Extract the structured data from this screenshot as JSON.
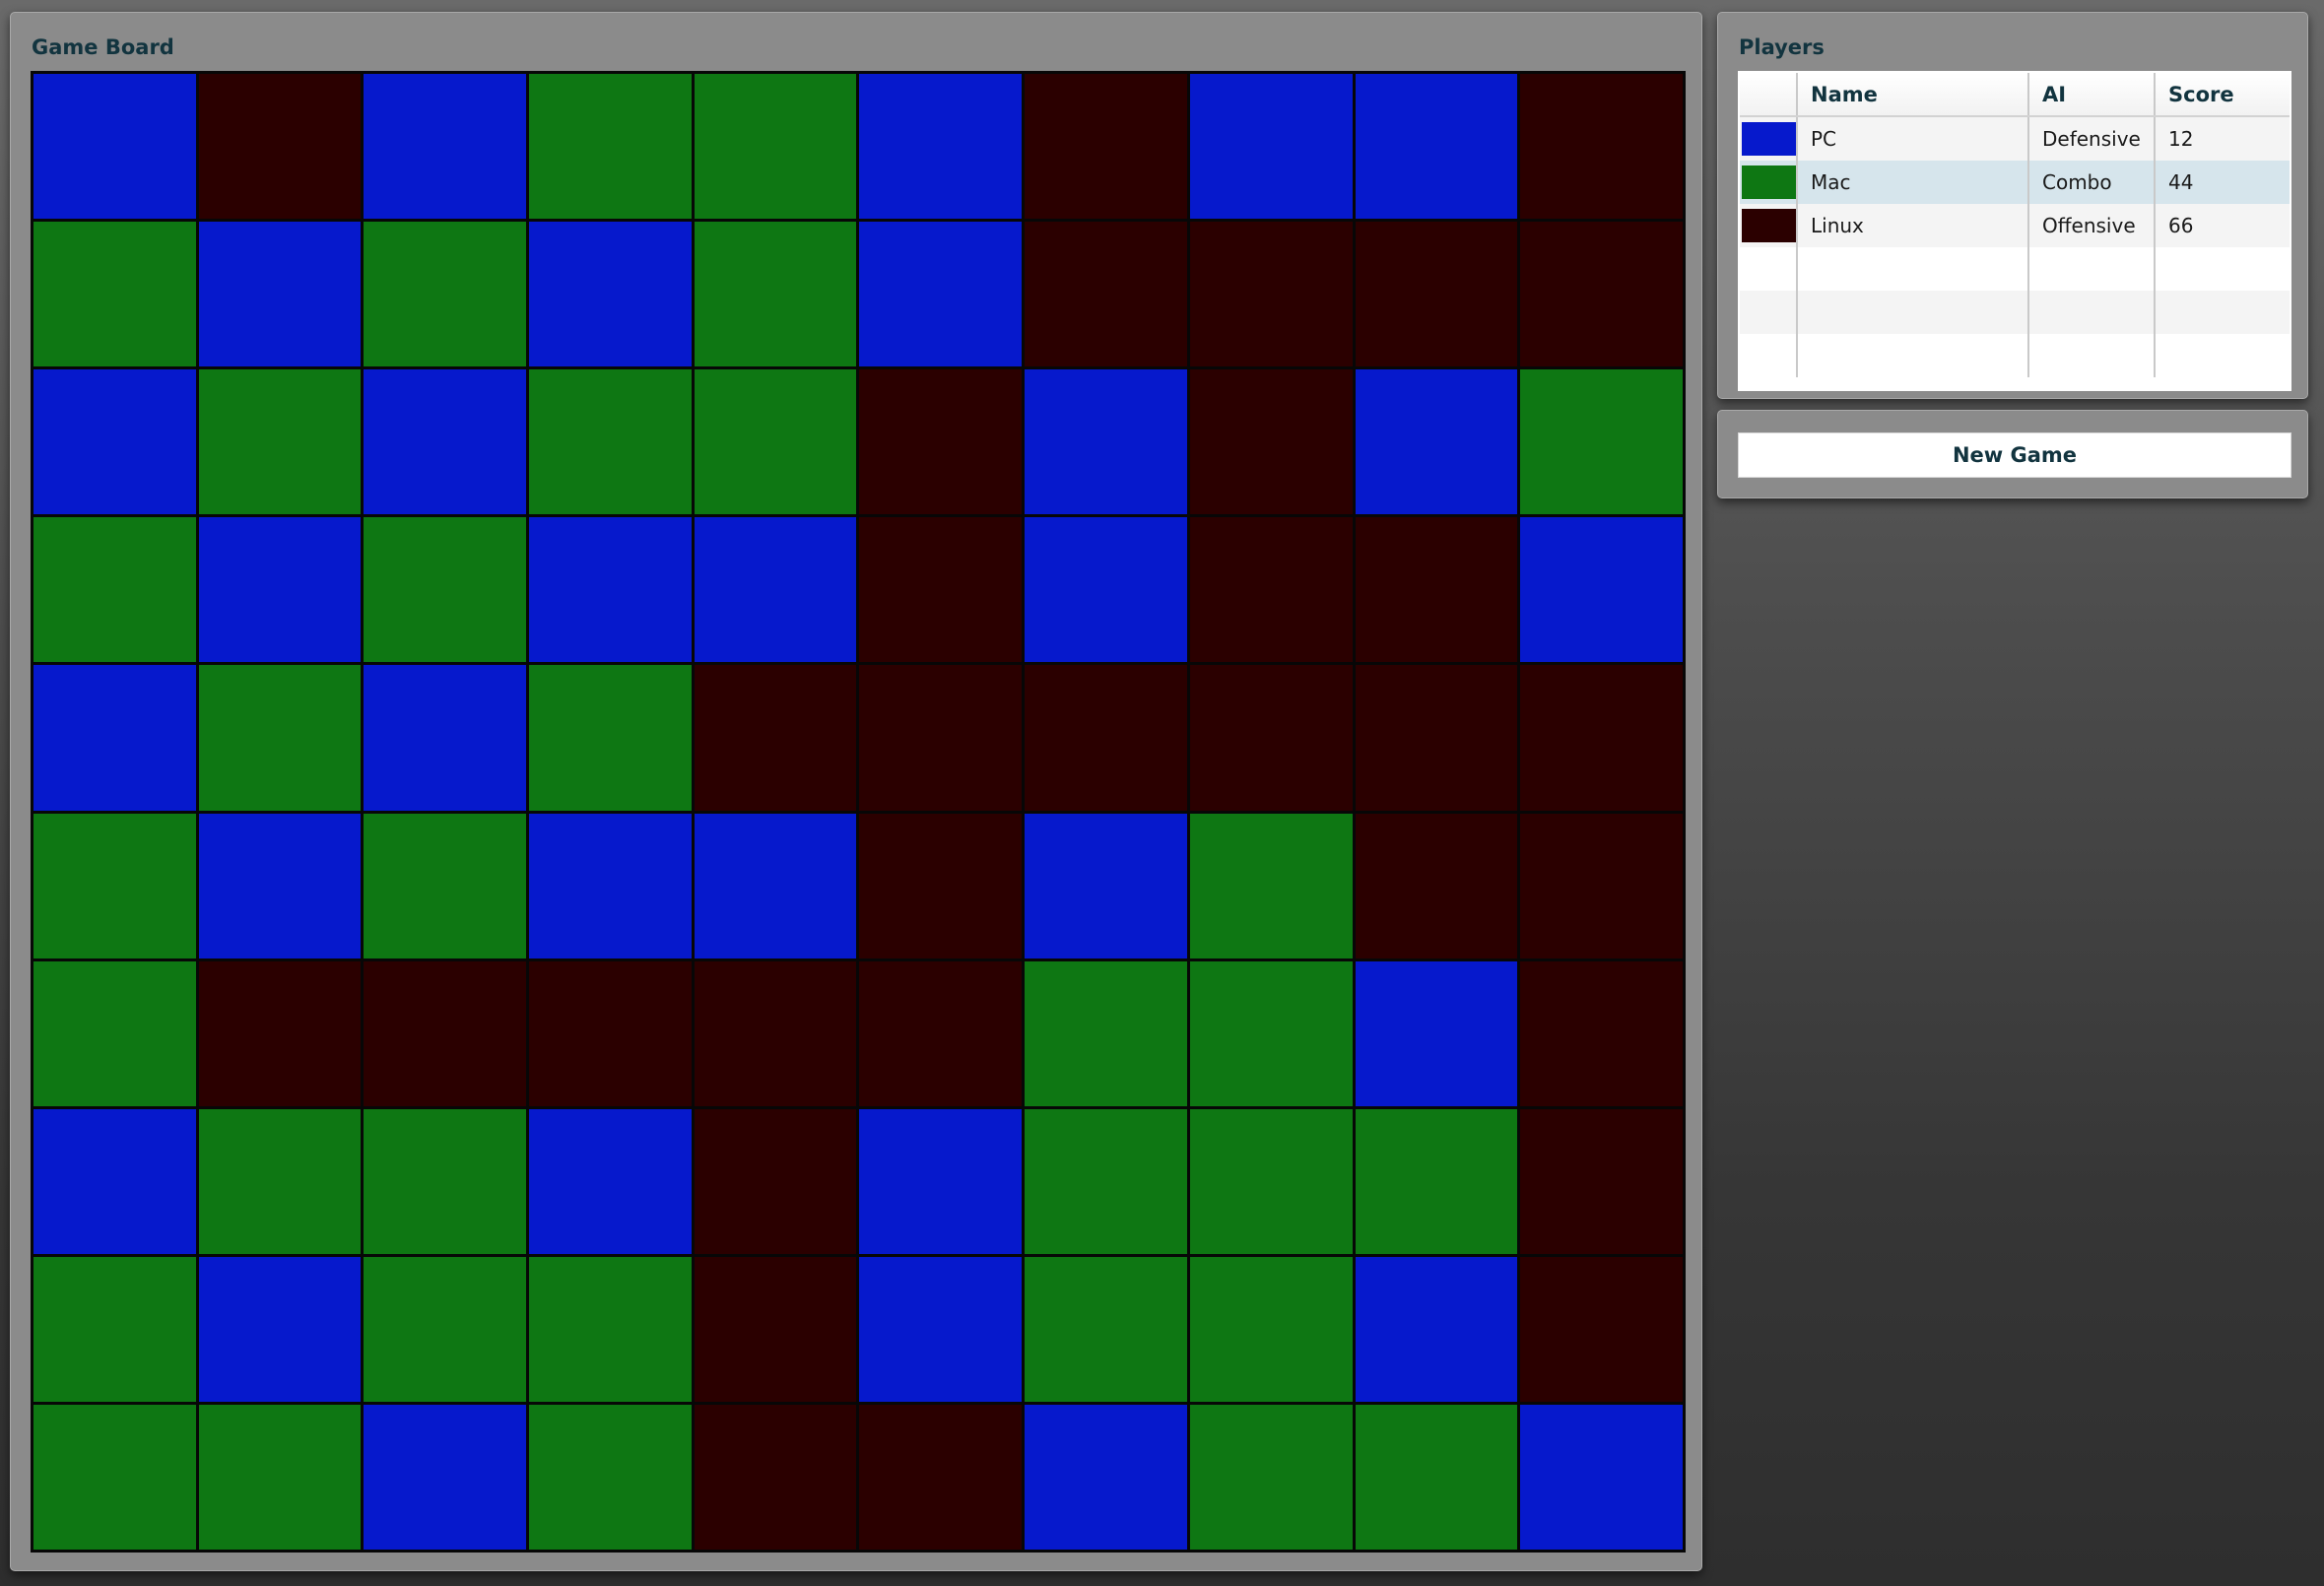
{
  "board_panel": {
    "title": "Game Board"
  },
  "board": {
    "color_key": {
      "B": "#0619cc",
      "G": "#0e7713",
      "D": "#2b0000"
    },
    "rows": [
      [
        "B",
        "D",
        "B",
        "G",
        "G",
        "B",
        "D",
        "B",
        "B",
        "D"
      ],
      [
        "G",
        "B",
        "G",
        "B",
        "G",
        "B",
        "D",
        "D",
        "D",
        "D"
      ],
      [
        "B",
        "G",
        "B",
        "G",
        "G",
        "D",
        "B",
        "D",
        "B",
        "G"
      ],
      [
        "G",
        "B",
        "G",
        "B",
        "B",
        "D",
        "B",
        "D",
        "D",
        "B"
      ],
      [
        "B",
        "G",
        "B",
        "G",
        "D",
        "D",
        "D",
        "D",
        "D",
        "D"
      ],
      [
        "G",
        "B",
        "G",
        "B",
        "B",
        "D",
        "B",
        "G",
        "D",
        "D"
      ],
      [
        "G",
        "D",
        "D",
        "D",
        "D",
        "D",
        "G",
        "G",
        "B",
        "D"
      ],
      [
        "B",
        "G",
        "G",
        "B",
        "D",
        "B",
        "G",
        "G",
        "G",
        "D"
      ],
      [
        "G",
        "B",
        "G",
        "G",
        "D",
        "B",
        "G",
        "G",
        "B",
        "D"
      ],
      [
        "G",
        "G",
        "B",
        "G",
        "D",
        "D",
        "B",
        "G",
        "G",
        "B"
      ]
    ]
  },
  "players_panel": {
    "title": "Players",
    "columns": [
      "",
      "Name",
      "AI",
      "Score"
    ],
    "players": [
      {
        "color": "#0619cc",
        "name": "PC",
        "ai": "Defensive",
        "score": "12"
      },
      {
        "color": "#0e7713",
        "name": "Mac",
        "ai": "Combo",
        "score": "44"
      },
      {
        "color": "#2b0000",
        "name": "Linux",
        "ai": "Offensive",
        "score": "66"
      },
      {
        "color": "",
        "name": "",
        "ai": "",
        "score": ""
      },
      {
        "color": "",
        "name": "",
        "ai": "",
        "score": ""
      },
      {
        "color": "",
        "name": "",
        "ai": "",
        "score": ""
      }
    ],
    "selected_row": 1
  },
  "actions": {
    "new_game_label": "New Game"
  }
}
